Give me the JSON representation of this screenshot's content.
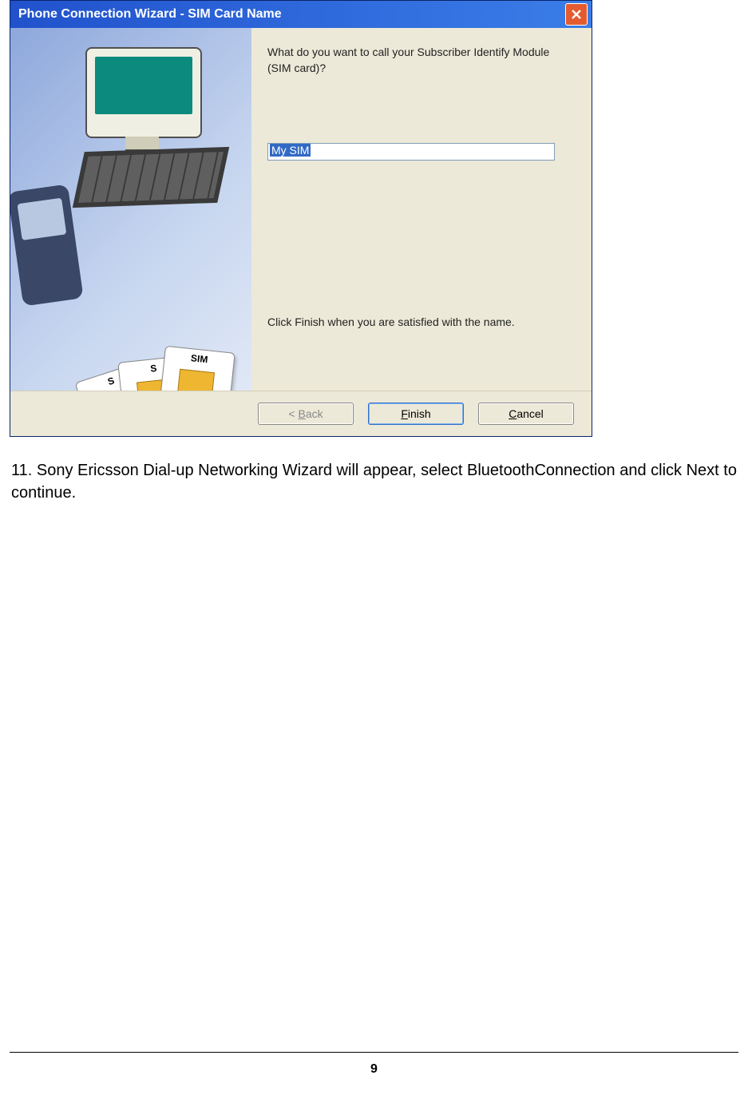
{
  "wizard": {
    "title": "Phone Connection Wizard - SIM Card Name",
    "prompt": "What do you want to call your Subscriber Identify Module (SIM card)?",
    "input_value": "My SIM",
    "hint": "Click Finish when you are satisfied with the name.",
    "buttons": {
      "back": "< Back",
      "finish": "Finish",
      "cancel": "Cancel"
    },
    "side_image": {
      "sim_label": "SIM"
    }
  },
  "step_text": "11. Sony Ericsson Dial-up Networking Wizard will appear, select BluetoothConnection and click Next to continue.",
  "page_number": "9"
}
